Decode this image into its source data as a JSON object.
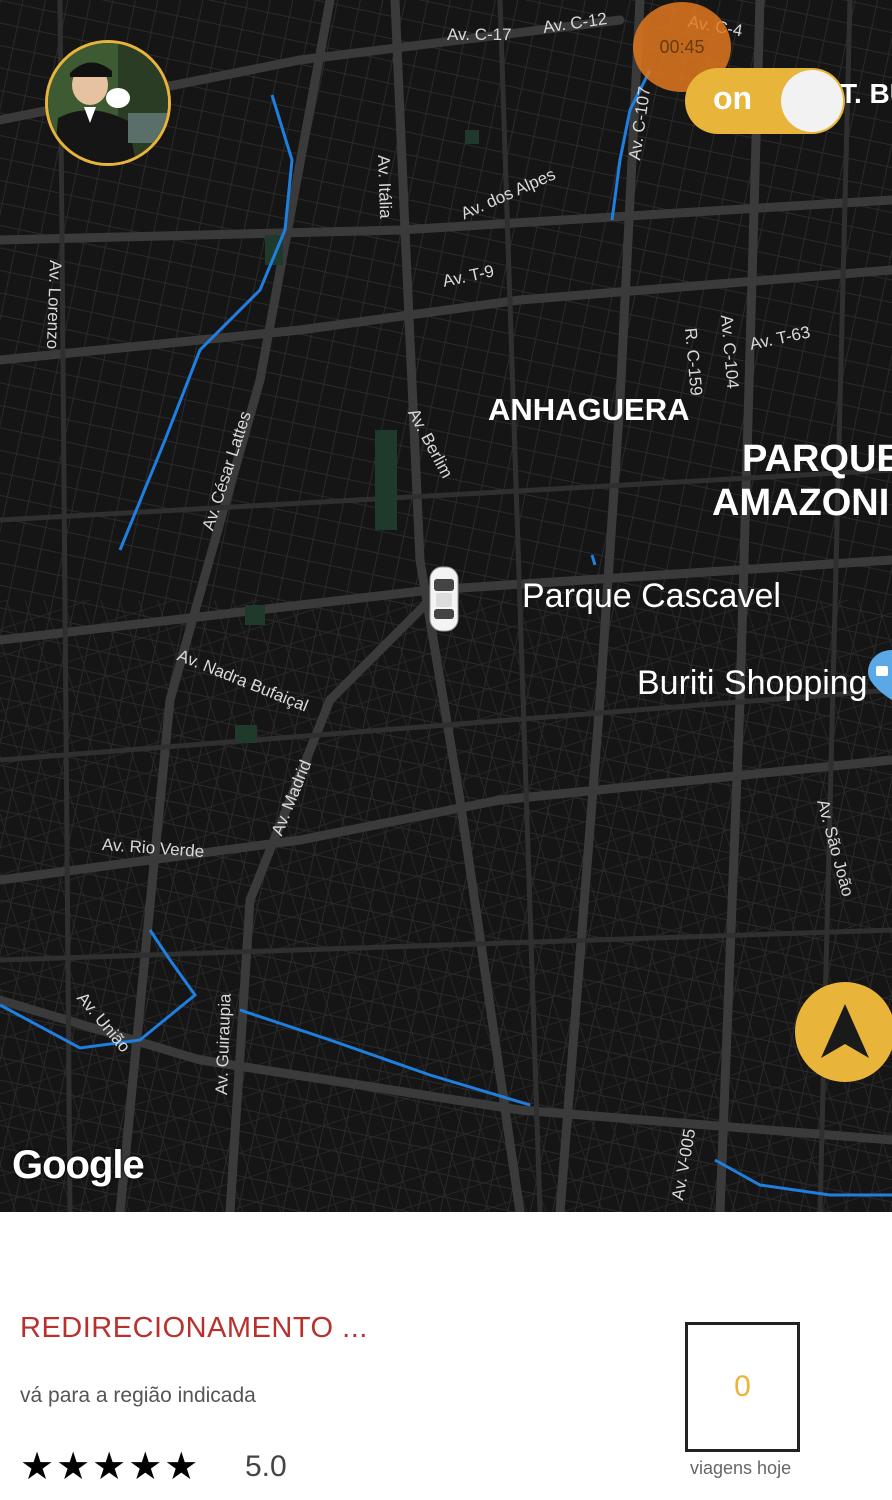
{
  "map": {
    "street_labels": {
      "c17": "Av. C-17",
      "c12": "Av. C-12",
      "c4": "Av. C-4",
      "c107": "Av. C-107",
      "italia": "Av. Itália",
      "alpes": "Av. dos Alpes",
      "lorenzo": "Av. Lorenzo",
      "t9": "Av. T-9",
      "c159": "R. C-159",
      "c104": "Av. C-104",
      "t63": "Av. T-63",
      "berlim": "Av. Berlim",
      "lattes": "Av. César Lattes",
      "nadra": "Av. Nadra Bufaiçal",
      "madrid": "Av. Madrid",
      "rioverde": "Av. Rio Verde",
      "saojoao": "Av. São João",
      "uniao": "Av. União",
      "guiraupia": "Av. Guiraupia",
      "v005": "Av. V-005",
      "tbu": "T. BU"
    },
    "neighborhoods": {
      "anhaguera": "ANHAGUERA",
      "parque_line1": "PARQUE",
      "parque_line2": "AMAZONI"
    },
    "pois": {
      "cascavel": "Parque Cascavel",
      "buriti": "Buriti Shopping"
    },
    "google_logo": "Google"
  },
  "controls": {
    "timer": "00:45",
    "toggle_label": "on"
  },
  "icons": {
    "avatar": "driver-avatar",
    "car": "car-icon",
    "recenter": "navigation-arrow-icon",
    "poi": "shopping-pin-icon"
  },
  "colors": {
    "accent": "#e8b43a",
    "title_red": "#b8312c",
    "map_bg": "#151515",
    "water": "#1e7fe0"
  },
  "status": {
    "title": "REDIRECIONAMENTO ...",
    "subtitle": "vá para a região indicada",
    "stars": "★★★★★",
    "rating": "5.0",
    "trips_count": "0",
    "trips_label": "viagens hoje"
  }
}
